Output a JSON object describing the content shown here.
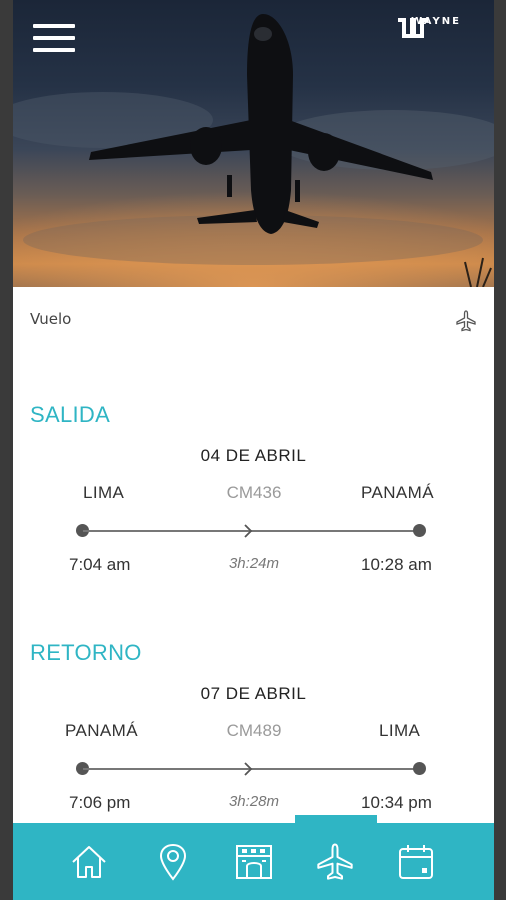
{
  "brand": {
    "logo_text": "WAYNE"
  },
  "section": {
    "title": "Vuelo"
  },
  "legs": [
    {
      "label": "SALIDA",
      "date": "04 DE ABRIL",
      "origin": "LIMA",
      "flight": "CM436",
      "destination": "PANAMÁ",
      "depart_time": "7:04 am",
      "duration": "3h:24m",
      "arrive_time": "10:28 am"
    },
    {
      "label": "RETORNO",
      "date": "07 DE ABRIL",
      "origin": "PANAMÁ",
      "flight": "CM489",
      "destination": "LIMA",
      "depart_time": "7:06 pm",
      "duration": "3h:28m",
      "arrive_time": "10:34 pm"
    }
  ],
  "nav": {
    "items": [
      {
        "icon": "home-icon"
      },
      {
        "icon": "location-pin-icon"
      },
      {
        "icon": "hotel-icon"
      },
      {
        "icon": "airplane-icon",
        "active": true
      },
      {
        "icon": "calendar-icon"
      }
    ]
  },
  "colors": {
    "accent": "#2fb5c4",
    "background": "#ffffff",
    "text": "#333333"
  }
}
